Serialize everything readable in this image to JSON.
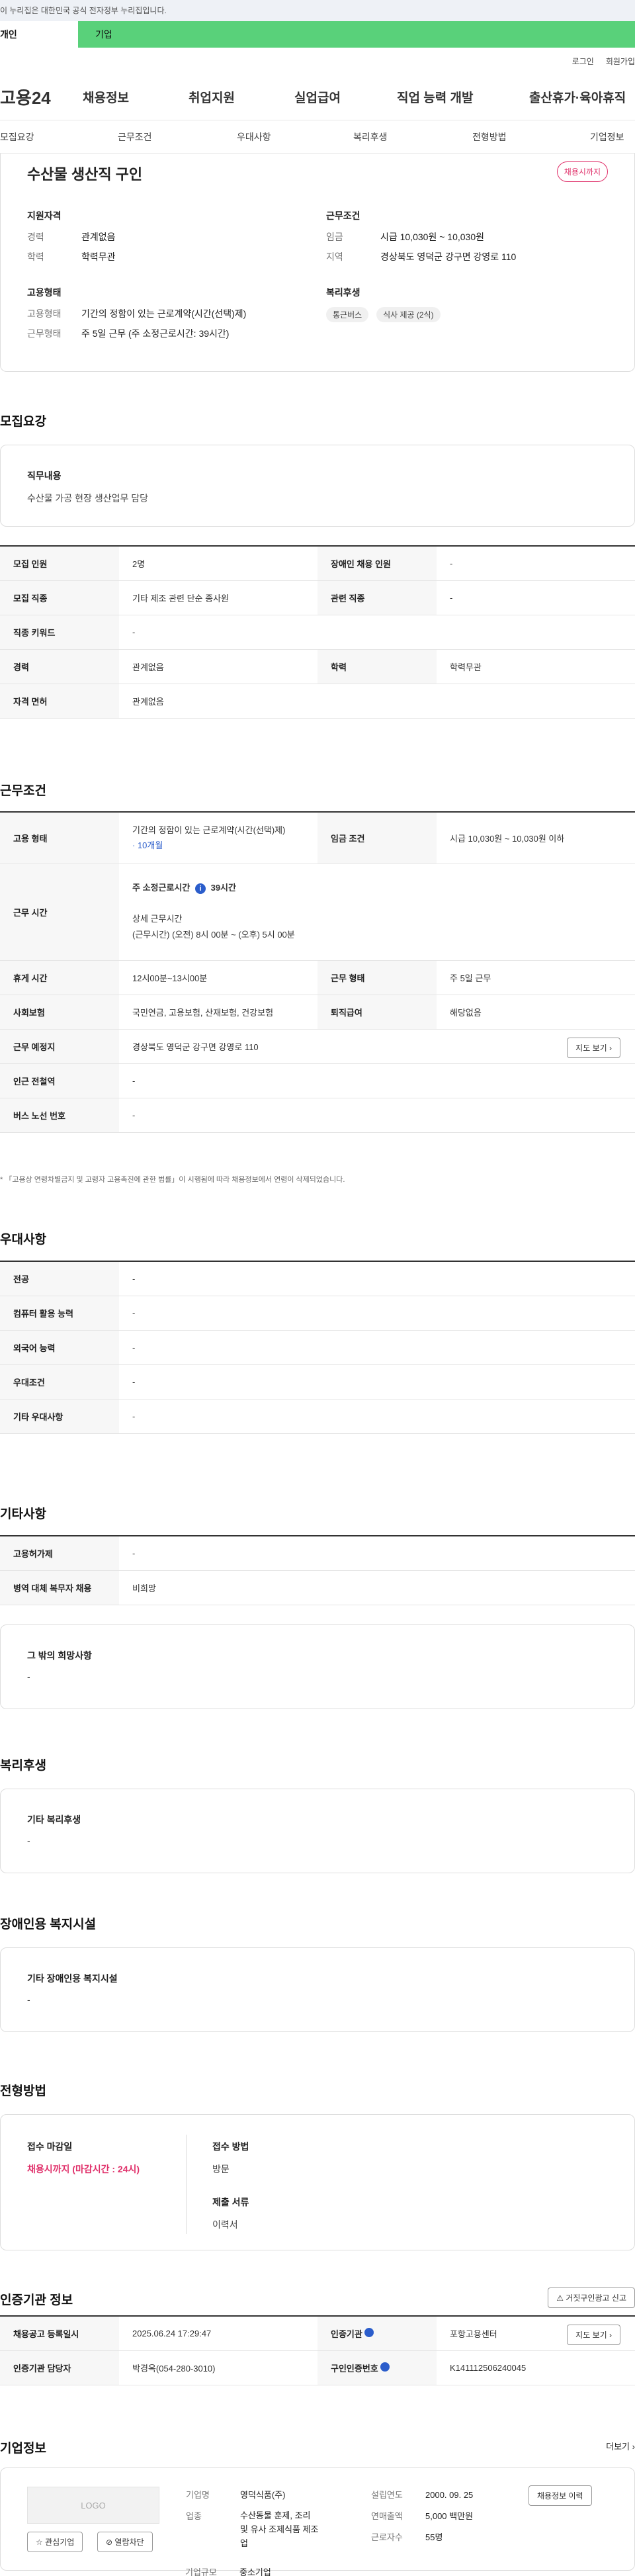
{
  "top_notice": "이 누리집은 대한민국 공식 전자정부 누리집입니다.",
  "user_tabs": [
    "개인",
    "기업"
  ],
  "util_links": [
    "로그인",
    "회원가입"
  ],
  "logo": "고용24",
  "gnb": [
    "채용정보",
    "취업지원",
    "실업급여",
    "직업 능력 개발",
    "출산휴가·육아휴직"
  ],
  "sub_tabs": [
    "모집요강",
    "근무조건",
    "우대사항",
    "복리후생",
    "전형방법",
    "기업정보"
  ],
  "job_title": "수산물 생산직 구인",
  "status_badge": "채용시까지",
  "summary": {
    "qual_title": "지원자격",
    "career_label": "경력",
    "career": "관계없음",
    "edu_label": "학력",
    "edu": "학력무관",
    "cond_title": "근무조건",
    "wage_label": "임금",
    "wage": "시급 10,030원 ~ 10,030원",
    "region_label": "지역",
    "region": "경상북도 영덕군 강구면 강영로 110",
    "type_title": "고용형태",
    "type1_label": "고용형태",
    "type1": "기간의 정함이 있는 근로계약(시간(선택)제)",
    "type2_label": "근무형태",
    "type2": "주 5일 근무 (주 소정근로시간: 39시간)",
    "welfare_title": "복리후생",
    "welfare_tags": [
      "통근버스",
      "식사 제공 (2식)"
    ]
  },
  "recruit": {
    "title": "모집요강",
    "duty_label": "직무내용",
    "duty": "수산물 가공 현장 생산업무 담당",
    "rows": [
      [
        "모집 인원",
        "2명",
        "장애인 채용 인원",
        "-"
      ],
      [
        "모집 직종",
        "기타 제조 관련 단순 종사원",
        "관련 직종",
        "-"
      ],
      [
        "직종 키워드",
        "-"
      ],
      [
        "경력",
        "관계없음",
        "학력",
        "학력무관"
      ],
      [
        "자격 면허",
        "관계없음"
      ]
    ]
  },
  "work": {
    "title": "근무조건",
    "type_label": "고용 형태",
    "type_value": "기간의 정함이 있는 근로계약(시간(선택)제)",
    "type_sub": "· 10개월",
    "wage_label": "임금 조건",
    "wage_value": "시급 10,030원 ~ 10,030원 이하",
    "hours_label": "근무 시간",
    "hours_main": "주 소정근로시간",
    "hours_info": "i",
    "hours_main_val": "39시간",
    "hours_detail_title": "상세 근무시간",
    "hours_detail": "(근무시간) (오전) 8시 00분 ~ (오후) 5시 00분",
    "rest_label": "휴게 시간",
    "rest": "12시00분~13시00분",
    "worktype_label": "근무 형태",
    "worktype": "주 5일 근무",
    "insure_label": "사회보험",
    "insure": "국민연금, 고용보험, 산재보험, 건강보험",
    "retire_label": "퇴직급여",
    "retire": "해당없음",
    "place_label": "근무 예정지",
    "place": "경상북도 영덕군 강구면 강영로 110",
    "map_btn": "지도 보기",
    "subway_label": "인근 전철역",
    "subway": "-",
    "bus_label": "버스 노선 번호",
    "bus": "-",
    "note": "* 「고용상 연령차별금지 및 고령자 고용촉진에 관한 법률」이 시행됨에 따라 채용정보에서 연령이 삭제되었습니다."
  },
  "pref": {
    "title": "우대사항",
    "rows": [
      [
        "전공",
        "-"
      ],
      [
        "컴퓨터 활용 능력",
        "-"
      ],
      [
        "외국어 능력",
        "-"
      ],
      [
        "우대조건",
        "-"
      ],
      [
        "기타 우대사항",
        "-"
      ]
    ]
  },
  "etc": {
    "title": "기타사항",
    "rows": [
      [
        "고용허가제",
        "-"
      ],
      [
        "병역 대체 복무자 채용",
        "비희망"
      ]
    ],
    "other_title": "그 밖의 희망사항",
    "other": "-"
  },
  "welfare": {
    "title": "복리후생",
    "box_title": "기타 복리후생",
    "box_value": "-"
  },
  "disabled": {
    "title": "장애인용 복지시설",
    "box_title": "기타 장애인용 복지시설",
    "box_value": "-"
  },
  "selection": {
    "title": "전형방법",
    "deadline_label": "접수 마감일",
    "deadline": "채용시까지 (마감시간 : 24시)",
    "method_label": "접수 방법",
    "method": "방문",
    "docs_label": "제출 서류",
    "docs": "이력서"
  },
  "cert": {
    "title": "인증기관 정보",
    "report_btn": "거짓구인광고 신고",
    "reg_label": "채용공고 등록일시",
    "reg": "2025.06.24 17:29:47",
    "agency_label": "인증기관",
    "agency": "포항고용센터",
    "map_btn": "지도 보기",
    "manager_label": "인증기관 담당자",
    "manager": "박경옥(054-280-3010)",
    "num_label": "구인인증번호",
    "num": "K141112506240045"
  },
  "company": {
    "title": "기업정보",
    "more": "더보기",
    "logo_text": "LOGO",
    "fav_btn": "관심기업",
    "block_btn": "열람차단",
    "name_label": "기업명",
    "name": "영덕식품(주)",
    "ind_label": "업종",
    "ind": "수산동물 훈제, 조리 및 유사 조제식품 제조업",
    "size_label": "기업규모",
    "size": "중소기업",
    "est_label": "설립연도",
    "est": "2000. 09. 25",
    "sales_label": "연매출액",
    "sales": "5,000 백만원",
    "emp_label": "근로자수",
    "emp": "55명",
    "history_btn": "채용정보 이력"
  }
}
